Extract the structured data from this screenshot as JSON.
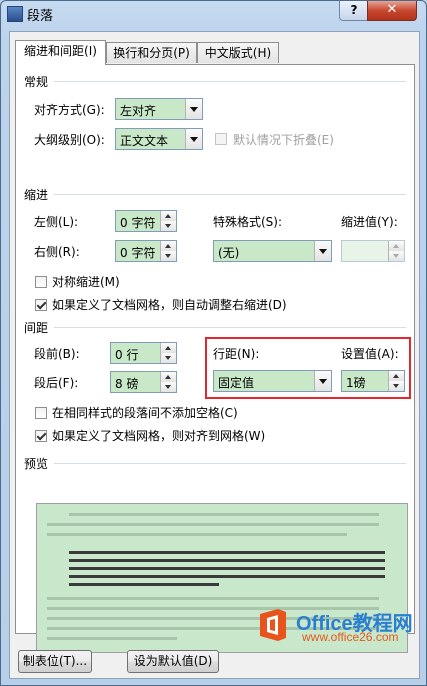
{
  "window": {
    "title": "段落",
    "help_label": "?",
    "close_label": "✕"
  },
  "tabs": [
    {
      "label": "缩进和间距(I)",
      "active": true
    },
    {
      "label": "换行和分页(P)",
      "active": false
    },
    {
      "label": "中文版式(H)",
      "active": false
    }
  ],
  "general": {
    "section": "常规",
    "alignment_label": "对齐方式(G):",
    "alignment_value": "左对齐",
    "outline_label": "大纲级别(O):",
    "outline_value": "正文文本",
    "collapse_label": "默认情况下折叠(E)"
  },
  "indent": {
    "section": "缩进",
    "left_label": "左侧(L):",
    "left_value": "0 字符",
    "right_label": "右侧(R):",
    "right_value": "0 字符",
    "special_label": "特殊格式(S):",
    "special_value": "(无)",
    "by_label": "缩进值(Y):",
    "by_value": "",
    "mirror_label": "对称缩进(M)",
    "mirror_checked": false,
    "auto_adjust_label": "如果定义了文档网格，则自动调整右缩进(D)",
    "auto_adjust_checked": true
  },
  "spacing": {
    "section": "间距",
    "before_label": "段前(B):",
    "before_value": "0 行",
    "after_label": "段后(F):",
    "after_value": "8 磅",
    "line_spacing_label": "行距(N):",
    "line_spacing_value": "固定值",
    "at_label": "设置值(A):",
    "at_value": "1磅",
    "no_space_label": "在相同样式的段落间不添加空格(C)",
    "no_space_checked": false,
    "snap_grid_label": "如果定义了文档网格，则对齐到网格(W)",
    "snap_grid_checked": true
  },
  "preview": {
    "section": "预览",
    "prev_text": "前一段落前一段落前一段落前一段落前一段落前一段落前一段落前一段落前一段落前一段落",
    "sample_text": "示例文字 示例文字 示例文字 示例文字 示例文字 示例文字 示例文字 示例文字 示例文字 示例文字",
    "next_text": "下一段落下一段落下一段落下一段落下一段落下一段落下一段落下一段落下一段落下一段落"
  },
  "buttons": {
    "tabs_label": "制表位(T)...",
    "default_label": "设为默认值(D)"
  },
  "watermark": {
    "name": "Office教程网",
    "url": "www.office26.com"
  },
  "colors": {
    "field_green": "#c8e8c8",
    "highlight_red": "#e3282d",
    "preview_green": "#c9e7cb"
  }
}
